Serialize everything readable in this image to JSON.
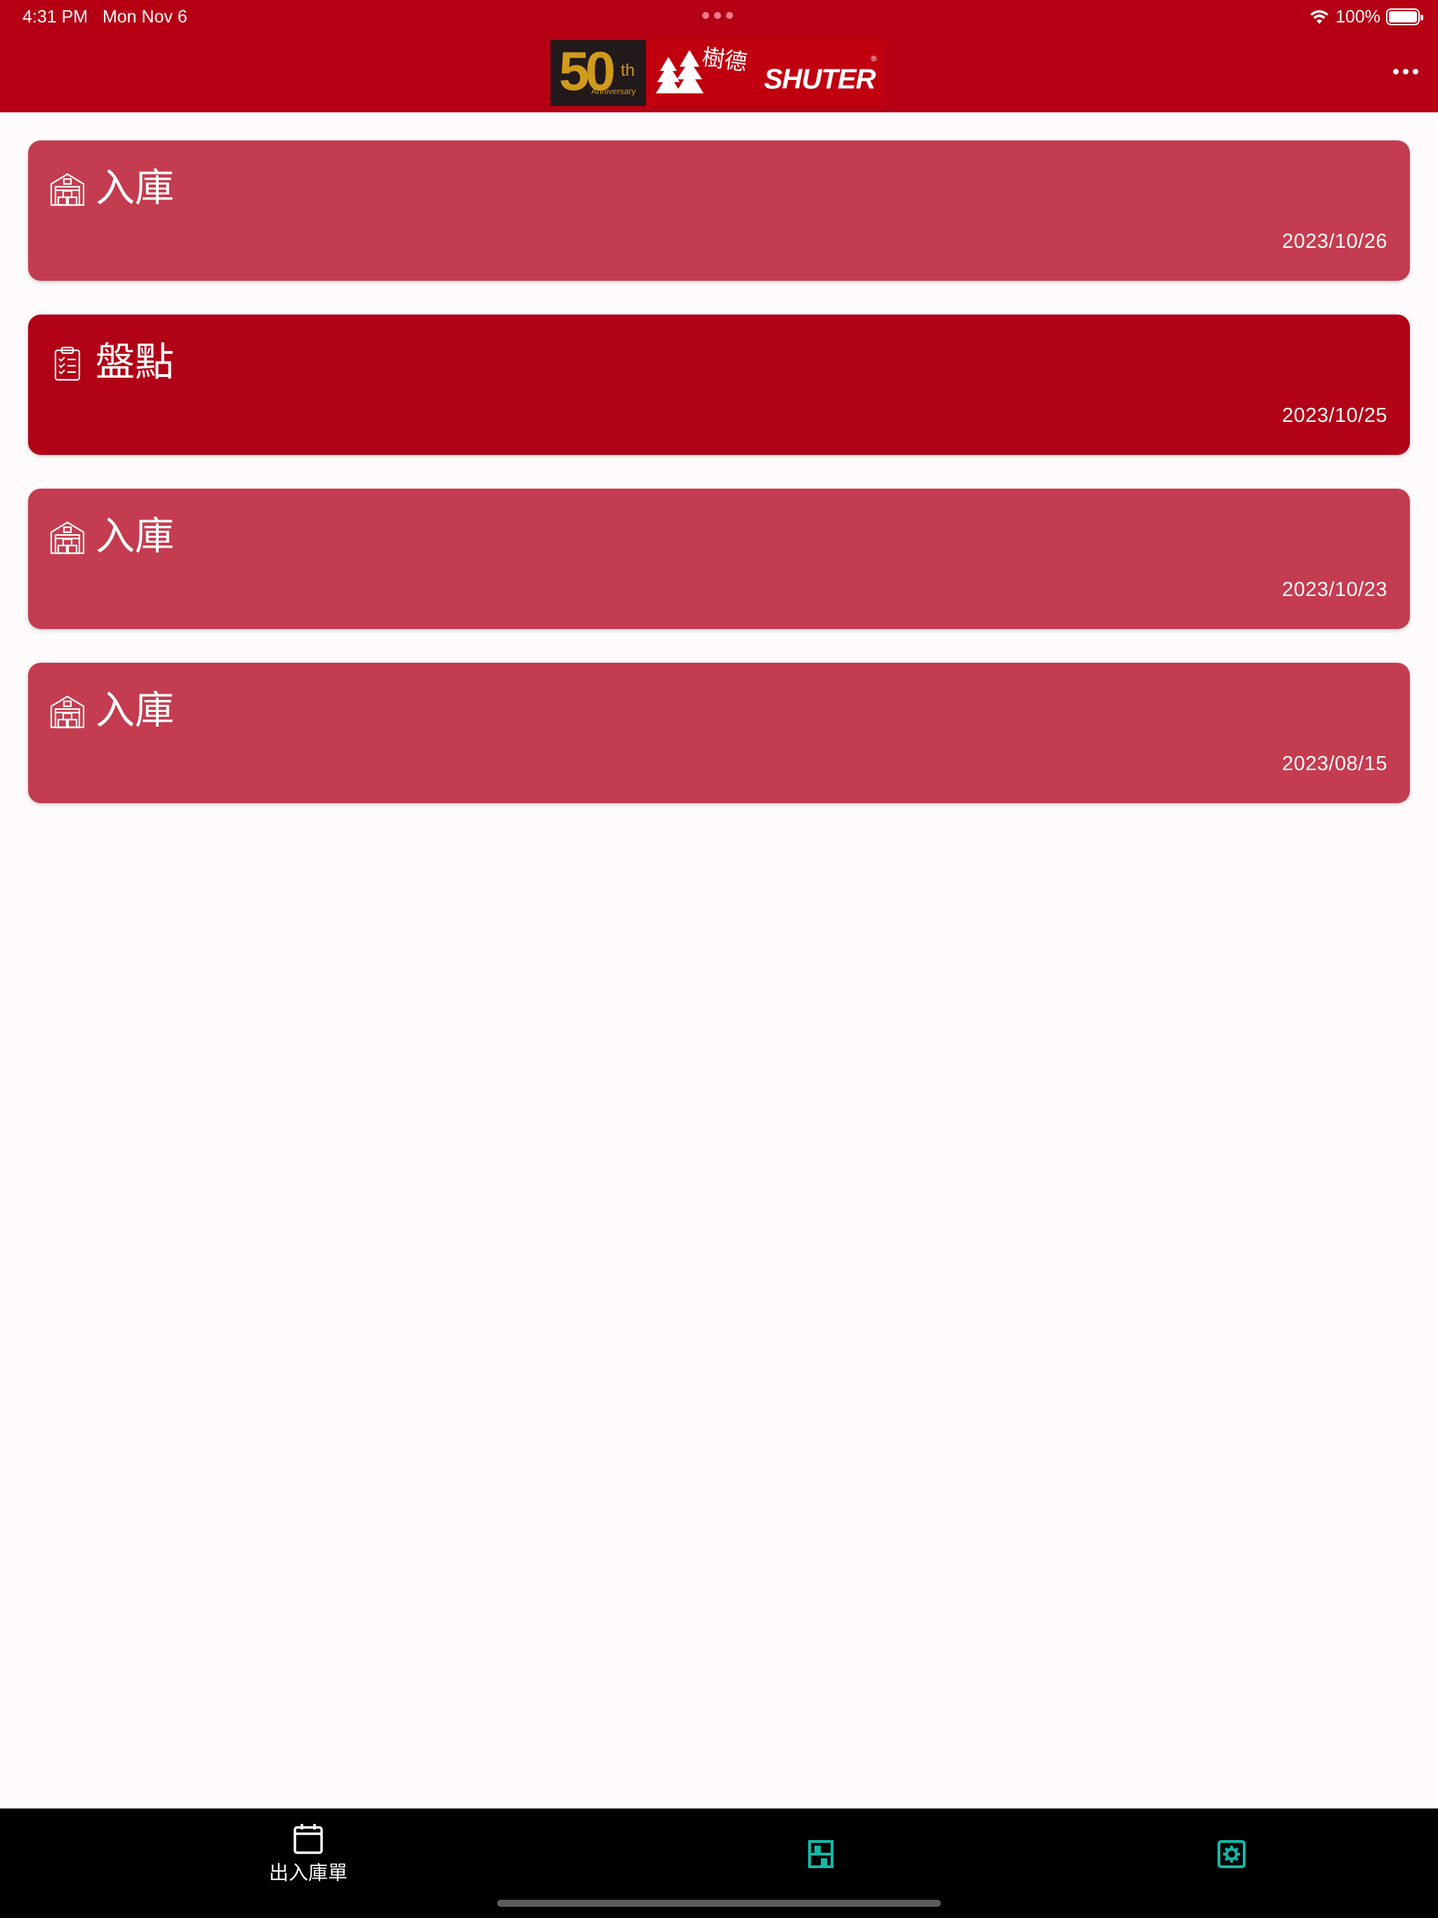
{
  "status_bar": {
    "time": "4:31 PM",
    "date": "Mon Nov 6",
    "battery_percent": "100%",
    "wifi_icon": "wifi-icon",
    "battery_icon": "battery-full-icon"
  },
  "app_bar": {
    "logo": {
      "anniversary_number": "50",
      "anniversary_suffix": "th",
      "anniversary_text": "Anniversary",
      "brand_chinese": "樹德",
      "brand_name": "SHUTER",
      "registered_mark": "®"
    },
    "more_icon": "more-horizontal-icon"
  },
  "records": [
    {
      "type": "inbound",
      "title": "入庫",
      "date": "2023/10/26",
      "icon": "warehouse-icon",
      "color": "#c43c4f"
    },
    {
      "type": "stocktake",
      "title": "盤點",
      "date": "2023/10/25",
      "icon": "clipboard-checklist-icon",
      "color": "#b10217"
    },
    {
      "type": "inbound",
      "title": "入庫",
      "date": "2023/10/23",
      "icon": "warehouse-icon",
      "color": "#c43c4f"
    },
    {
      "type": "inbound",
      "title": "入庫",
      "date": "2023/08/15",
      "icon": "warehouse-icon",
      "color": "#c43c4f"
    }
  ],
  "bottom_nav": {
    "items": [
      {
        "label": "出入庫單",
        "icon": "calendar-icon",
        "active": true
      },
      {
        "label": "",
        "icon": "shelf-icon",
        "active": false
      },
      {
        "label": "",
        "icon": "settings-gear-icon",
        "active": false
      }
    ],
    "accent_color": "#14b8a6"
  },
  "colors": {
    "header_red": "#b50014",
    "background": "#fffbfd",
    "nav_background": "#000000"
  }
}
